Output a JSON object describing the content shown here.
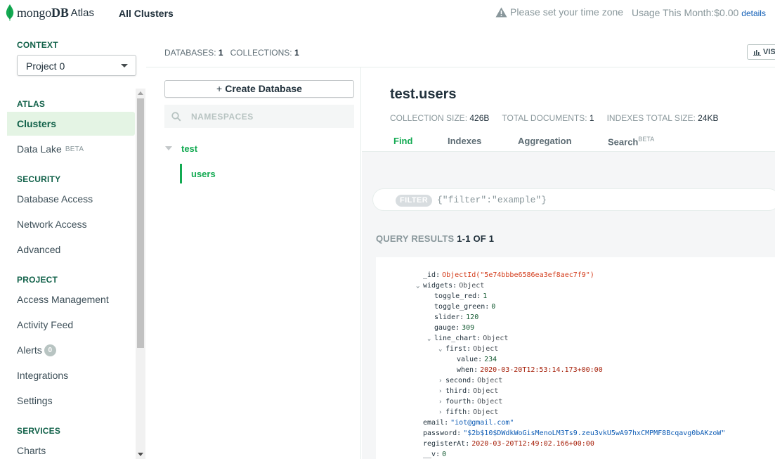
{
  "header": {
    "brand_word1": "mongo",
    "brand_word2": "DB",
    "brand_suffix": "Atlas",
    "all_clusters": "All Clusters",
    "timezone_warning": "Please set your time zone",
    "usage": "Usage This Month:$0.00",
    "details_link": "details"
  },
  "sidebar": {
    "context_label": "CONTEXT",
    "project": "Project 0",
    "sections": [
      {
        "label": "ATLAS",
        "items": [
          {
            "label": "Clusters",
            "active": true
          },
          {
            "label": "Data Lake",
            "badge": "BETA"
          }
        ]
      },
      {
        "label": "SECURITY",
        "items": [
          {
            "label": "Database Access"
          },
          {
            "label": "Network Access"
          },
          {
            "label": "Advanced"
          }
        ]
      },
      {
        "label": "PROJECT",
        "items": [
          {
            "label": "Access Management"
          },
          {
            "label": "Activity Feed"
          },
          {
            "label": "Alerts",
            "count": "0"
          },
          {
            "label": "Integrations"
          },
          {
            "label": "Settings"
          }
        ]
      },
      {
        "label": "SERVICES",
        "items": [
          {
            "label": "Charts"
          }
        ]
      }
    ]
  },
  "counts": {
    "databases_label": "DATABASES:",
    "databases_value": "1",
    "collections_label": "COLLECTIONS:",
    "collections_value": "1",
    "visualize_label": "VIS"
  },
  "db_panel": {
    "create_db_label": "Create Database",
    "namespaces_placeholder": "NAMESPACES",
    "database": "test",
    "collection": "users"
  },
  "collection": {
    "title": "test.users",
    "size_label": "COLLECTION SIZE:",
    "size_value": "426B",
    "docs_label": "TOTAL DOCUMENTS:",
    "docs_value": "1",
    "index_label": "INDEXES TOTAL SIZE:",
    "index_value": "24KB",
    "tabs": [
      {
        "label": "Find",
        "active": true
      },
      {
        "label": "Indexes"
      },
      {
        "label": "Aggregation"
      },
      {
        "label": "Search",
        "sup": "BETA"
      }
    ],
    "filter_pill": "FILTER",
    "filter_value": "{\"filter\":\"example\"}",
    "query_results_label": "QUERY RESULTS",
    "query_results_range": "1-1 OF 1"
  },
  "document": [
    {
      "key": "_id",
      "value": "ObjectId(\"5e74bbbe6586ea3ef8aec7f9\")",
      "kind": "oid",
      "indent": 0
    },
    {
      "key": "widgets",
      "value": "Object",
      "kind": "type",
      "indent": 0,
      "chev": "open"
    },
    {
      "key": "toggle_red",
      "value": "1",
      "kind": "num",
      "indent": 1
    },
    {
      "key": "toggle_green",
      "value": "0",
      "kind": "num",
      "indent": 1
    },
    {
      "key": "slider",
      "value": "120",
      "kind": "num",
      "indent": 1
    },
    {
      "key": "gauge",
      "value": "309",
      "kind": "num",
      "indent": 1
    },
    {
      "key": "line_chart",
      "value": "Object",
      "kind": "type",
      "indent": 1,
      "chev": "open"
    },
    {
      "key": "first",
      "value": "Object",
      "kind": "type",
      "indent": 2,
      "chev": "open"
    },
    {
      "key": "value",
      "value": "234",
      "kind": "num",
      "indent": 3
    },
    {
      "key": "when",
      "value": "2020-03-20T12:53:14.173+00:00",
      "kind": "date",
      "indent": 3
    },
    {
      "key": "second",
      "value": "Object",
      "kind": "type",
      "indent": 2,
      "chev": "closed"
    },
    {
      "key": "third",
      "value": "Object",
      "kind": "type",
      "indent": 2,
      "chev": "closed"
    },
    {
      "key": "fourth",
      "value": "Object",
      "kind": "type",
      "indent": 2,
      "chev": "closed"
    },
    {
      "key": "fifth",
      "value": "Object",
      "kind": "type",
      "indent": 2,
      "chev": "closed"
    },
    {
      "key": "email",
      "value": "\"iot@gmail.com\"",
      "kind": "str",
      "indent": 0
    },
    {
      "key": "password",
      "value": "\"$2b$10$DWdkWoGisMenoLM3Ts9.zeu3vkU5wA97hxCMPMF8Bcqavg0bAKzoW\"",
      "kind": "str",
      "indent": 0
    },
    {
      "key": "registerAt",
      "value": "2020-03-20T12:49:02.166+00:00",
      "kind": "date",
      "indent": 0
    },
    {
      "key": "__v",
      "value": "0",
      "kind": "num",
      "indent": 0
    }
  ],
  "colors": {
    "brand_green": "#13aa52",
    "active_nav_bg": "#e4f4e4",
    "section_label": "#116149",
    "link_blue": "#0e5cb5"
  }
}
